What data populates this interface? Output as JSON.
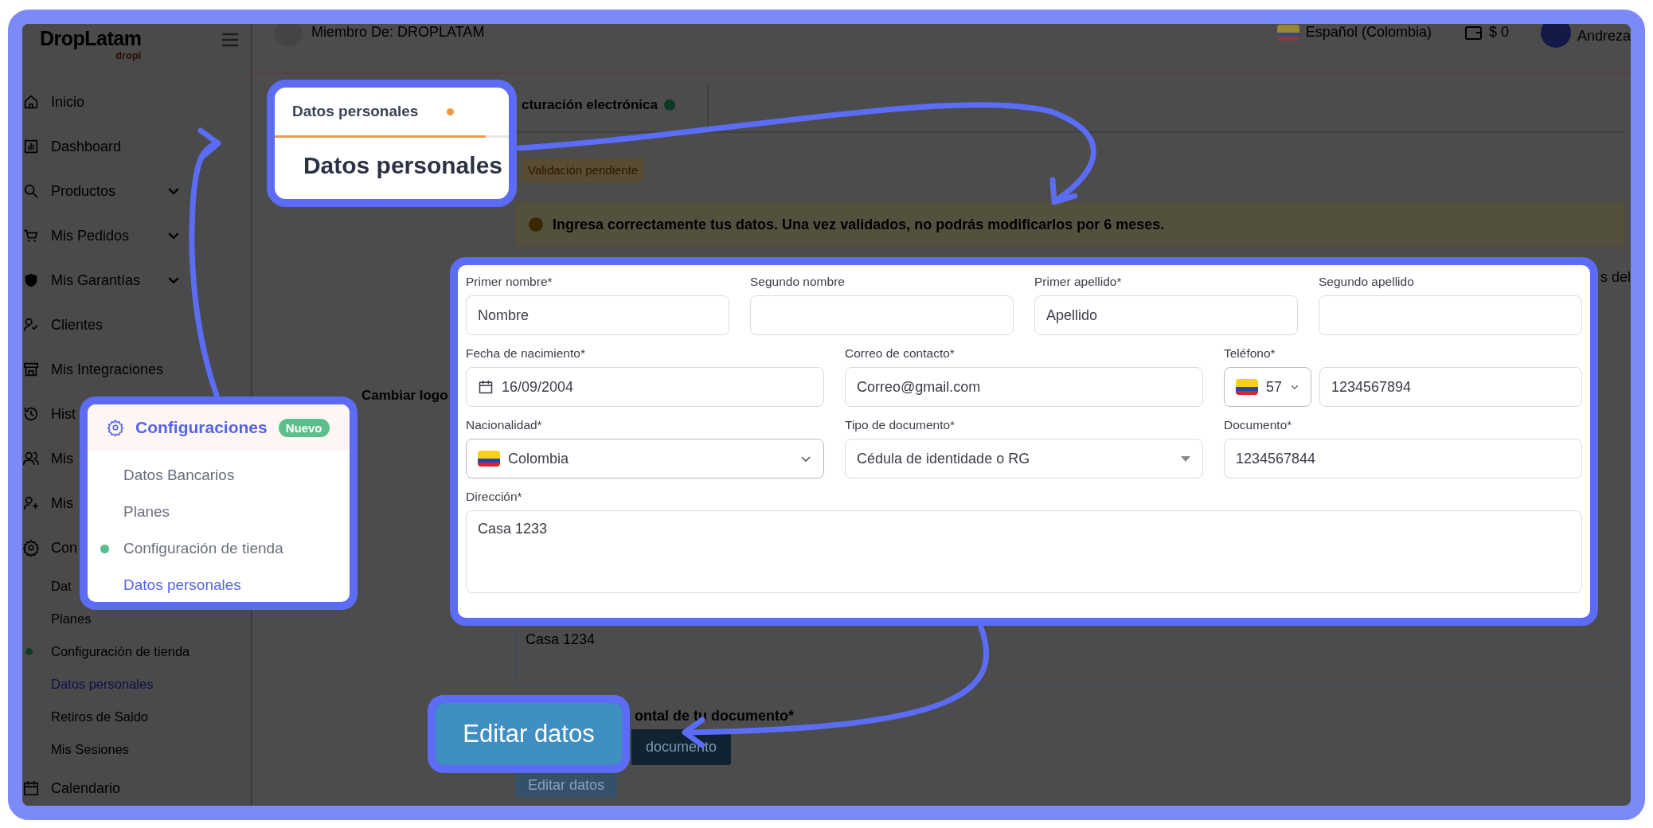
{
  "sidebar": {
    "logo": "DropLatam",
    "logo_sub": "dropi",
    "items": [
      {
        "label": "Inicio"
      },
      {
        "label": "Dashboard"
      },
      {
        "label": "Productos",
        "expanded": false
      },
      {
        "label": "Mis Pedidos",
        "expanded": false
      },
      {
        "label": "Mis Garantías",
        "expanded": false
      },
      {
        "label": "Clientes"
      },
      {
        "label": "Mis Integraciones"
      },
      {
        "label": "Hist"
      },
      {
        "label": "Mis"
      },
      {
        "label": "Mis"
      },
      {
        "label": "Con",
        "children": [
          {
            "label": "Dat",
            "dot": false,
            "selected": false
          },
          {
            "label": "Planes",
            "dot": false,
            "selected": false
          },
          {
            "label": "Configuración de tienda",
            "dot": true,
            "selected": false
          },
          {
            "label": "Datos personales",
            "dot": false,
            "selected": true
          },
          {
            "label": "Retiros de Saldo",
            "dot": false,
            "selected": false
          },
          {
            "label": "Mis Sesiones",
            "dot": false,
            "selected": false
          }
        ]
      },
      {
        "label": "Calendario"
      }
    ]
  },
  "header": {
    "member": "Miembro De: DROPLATAM",
    "language": "Español (Colombia)",
    "balance": "$ 0",
    "user": "Andreza"
  },
  "content": {
    "tab": "cturación electrónica",
    "status": "Validación pendiente",
    "alert": "Ingresa correctamente tus datos. Una vez validados, no podrás modificarlos por 6 meses.",
    "logo_heading": "Cambiar logo",
    "label_fragment": "s del",
    "address": "Casa 1234",
    "document_label": "ontal de tu documento*",
    "document_button": "documento",
    "edit_button": {
      "label": "Editar datos",
      "disabled": true
    }
  },
  "tab_callout": {
    "tab": "Datos personales",
    "dot": true,
    "heading": "Datos personales"
  },
  "menu_callout": {
    "title": "Configuraciones",
    "badge": "Nuevo",
    "items": [
      {
        "label": "Datos Bancarios",
        "dot": false,
        "selected": false
      },
      {
        "label": "Planes",
        "dot": false,
        "selected": false
      },
      {
        "label": "Configuración de tienda",
        "dot": true,
        "selected": false
      },
      {
        "label": "Datos personales",
        "dot": false,
        "selected": true
      }
    ]
  },
  "form_callout": {
    "rows": [
      [
        {
          "label": "Primer nombre*",
          "kind": "text",
          "value": "Nombre"
        },
        {
          "label": "Segundo nombre",
          "kind": "text"
        },
        {
          "label": "Primer apellido*",
          "kind": "text",
          "value": "Apellido"
        },
        {
          "label": "Segundo apellido",
          "kind": "text"
        }
      ],
      [
        {
          "label": "Fecha de nacimiento*",
          "kind": "date",
          "value": "16/09/2004"
        },
        {
          "label": "Correo de contacto*",
          "kind": "text",
          "value": "Correo@gmail.com"
        },
        {
          "label": "Teléfono*",
          "kind": "phone",
          "code": "57",
          "value": "1234567894"
        }
      ],
      [
        {
          "label": "Nacionalidad*",
          "kind": "country",
          "value": "Colombia"
        },
        {
          "label": "Tipo de documento*",
          "kind": "dropdown",
          "value": "Cédula de identidade o RG"
        },
        {
          "label": "Documento*",
          "kind": "text",
          "value": "1234567844"
        }
      ],
      [
        {
          "label": "Dirección*",
          "kind": "textarea",
          "value": "Casa 1233"
        }
      ]
    ]
  },
  "button_callout": {
    "label": "Editar datos"
  }
}
